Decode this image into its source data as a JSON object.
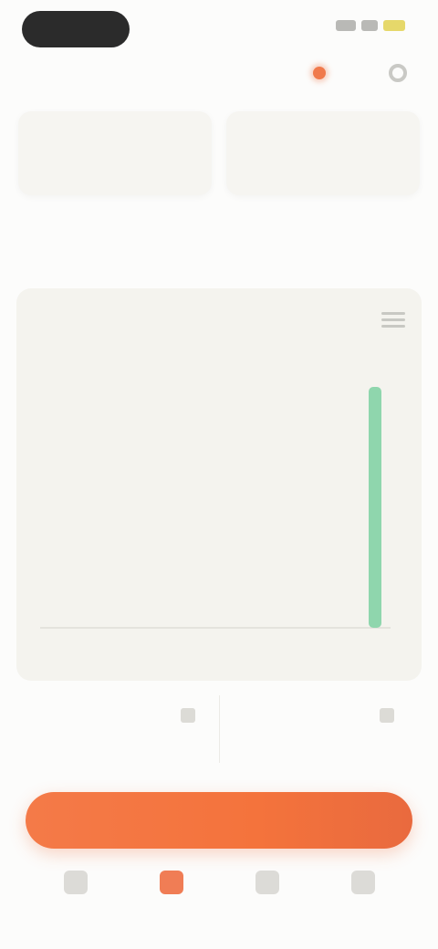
{
  "status_bar": {},
  "top_actions": {
    "icons": [
      "notification-icon",
      "settings-icon"
    ]
  },
  "cards": [
    {
      "label": "",
      "value": ""
    },
    {
      "label": "",
      "value": ""
    }
  ],
  "section": {
    "title": ""
  },
  "chart_data": {
    "type": "bar",
    "caption": "",
    "total": "",
    "categories": [],
    "series": [
      {
        "values": [
          0,
          0,
          0,
          0,
          0,
          0,
          0,
          0,
          0,
          0,
          0,
          0,
          0,
          0,
          0,
          0,
          0,
          0,
          1
        ]
      }
    ],
    "color": "#8fd6ad",
    "grid": false
  },
  "stats": [
    {
      "label": "",
      "value": ""
    },
    {
      "label": "",
      "value": ""
    }
  ],
  "cta": {
    "label": ""
  },
  "bottom_nav": {
    "items": [
      {
        "label": "",
        "icon": "home-icon",
        "active": false
      },
      {
        "label": "",
        "icon": "chart-icon",
        "active": true
      },
      {
        "label": "",
        "icon": "list-icon",
        "active": false
      },
      {
        "label": "",
        "icon": "profile-icon",
        "active": false
      }
    ]
  },
  "colors": {
    "accent": "#f47a48",
    "bar": "#8fd6ad",
    "panel": "#f4f3ee"
  }
}
